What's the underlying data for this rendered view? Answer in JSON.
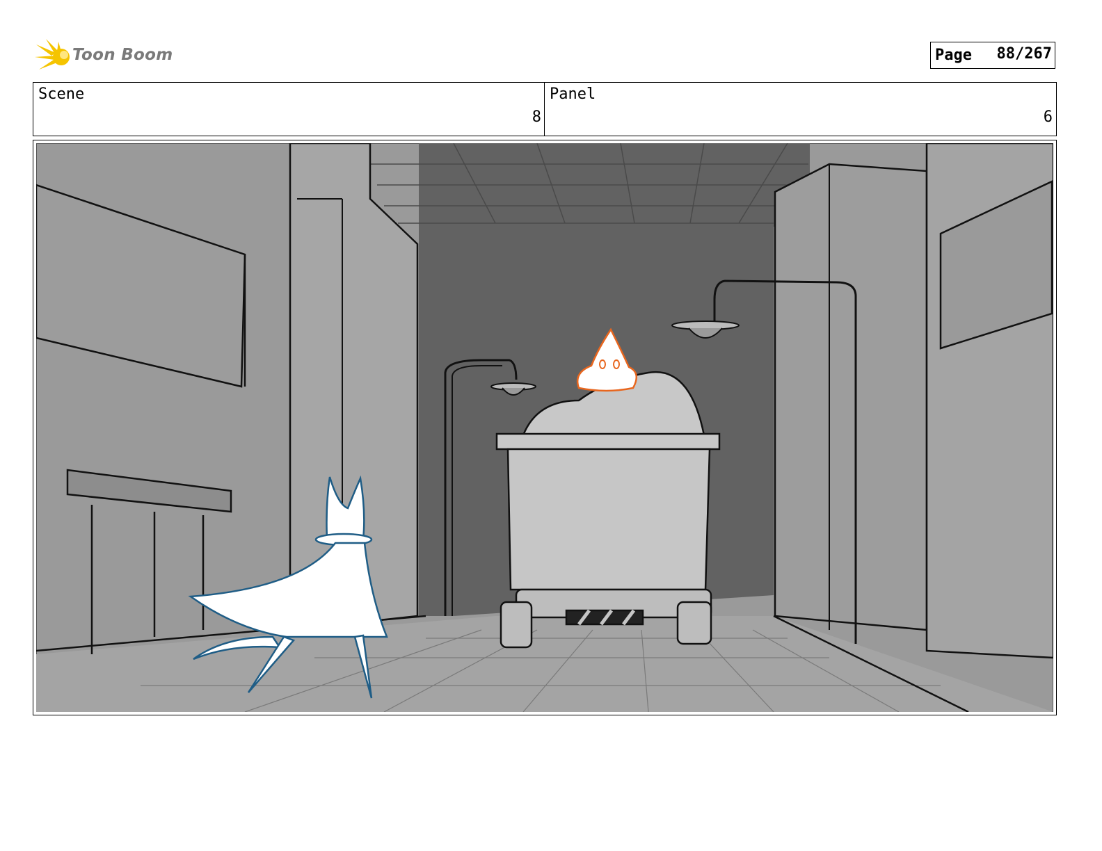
{
  "header": {
    "logo_text": "Toon Boom",
    "page_label": "Page",
    "page_value": "88/267"
  },
  "info": {
    "scene_label": "Scene",
    "scene_value": "8",
    "panel_label": "Panel",
    "panel_value": "6"
  },
  "colors": {
    "logo_accent": "#f5c400",
    "fire_accent": "#e8661e",
    "cat_outline": "#1f5d86"
  }
}
